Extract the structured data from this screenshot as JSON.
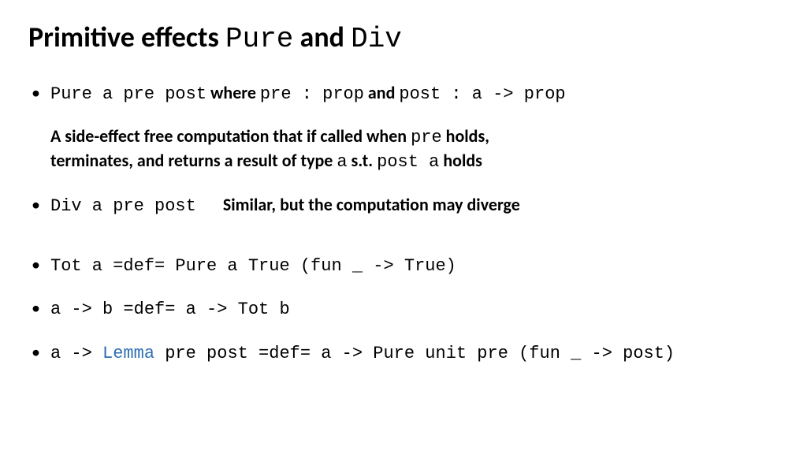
{
  "title": {
    "prefix": "Primitive effects ",
    "code1": "Pure",
    "mid": " and ",
    "code2": "Div"
  },
  "bullets": {
    "pure": {
      "sig": "Pure a pre post",
      "where": " where  ",
      "pre_type": "pre : prop",
      "and": "  and   ",
      "post_type": "post : a -> prop",
      "desc_l1_a": "A side-effect free computation that if called when ",
      "desc_l1_code": "pre",
      "desc_l1_b": " holds,",
      "desc_l2_a": "terminates, and returns a result of type ",
      "desc_l2_code1": "a",
      "desc_l2_b": " s.t. ",
      "desc_l2_code2": "post  a",
      "desc_l2_c": " holds"
    },
    "div": {
      "sig": "Div a pre post",
      "note": "Similar, but the computation may diverge"
    },
    "tot": {
      "line": "Tot a =def= Pure a True (fun _ -> True)"
    },
    "arrow": {
      "line": "a -> b =def= a -> Tot b"
    },
    "lemma": {
      "pre": "a -> ",
      "kw": "Lemma",
      "post": " pre post =def= a -> Pure unit pre (fun _ -> post)"
    }
  }
}
